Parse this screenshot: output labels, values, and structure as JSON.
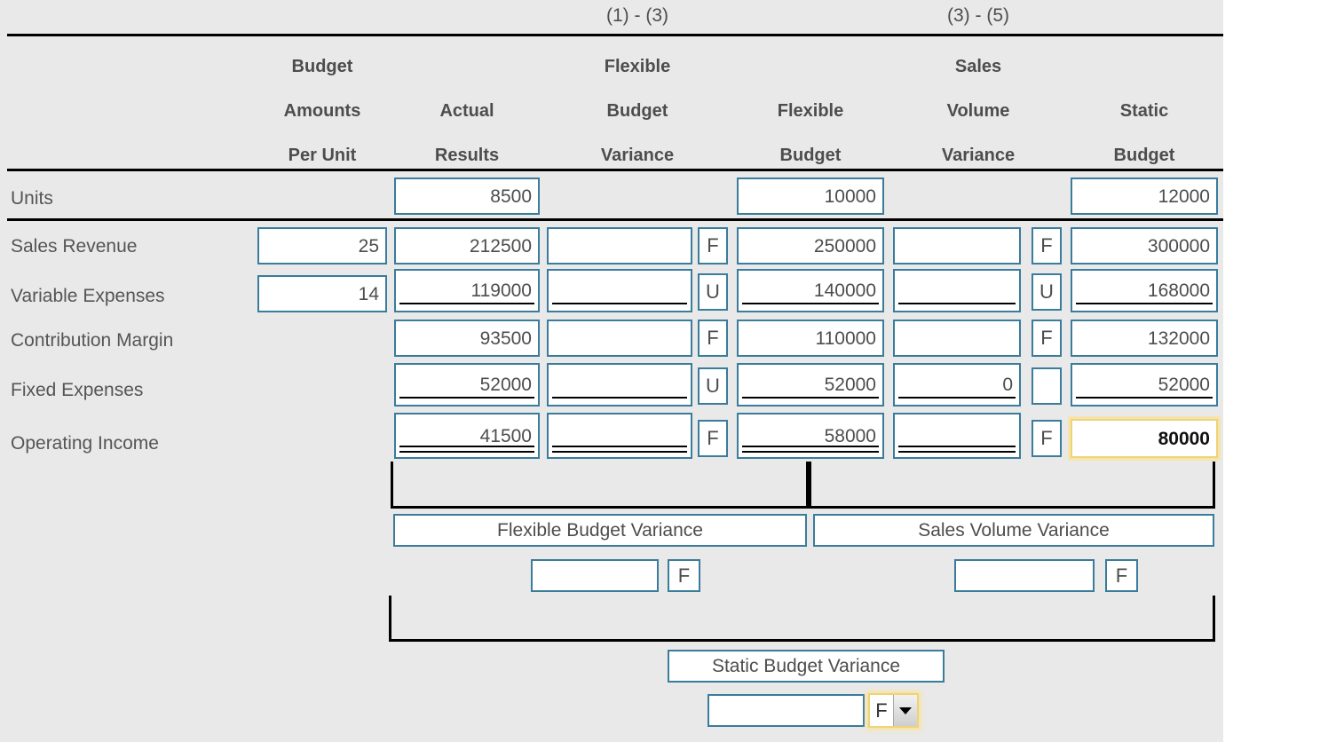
{
  "theme": {
    "page_bg": "#ffffff",
    "sheet_bg": "#e9e9e9",
    "input_border": "#3a7c9b",
    "highlight_border": "#efd27a",
    "text": "#4d4d4d",
    "rule": "#000000"
  },
  "header": {
    "equations": [
      {
        "label": "(1) - (3)"
      },
      {
        "label": "(3) - (5)"
      }
    ],
    "columns": [
      {
        "key": "budget_per_unit",
        "lines": [
          "Budget",
          "Amounts",
          "Per Unit"
        ]
      },
      {
        "key": "actual_results",
        "lines": [
          "",
          "Actual",
          "Results"
        ]
      },
      {
        "key": "flex_budget_var",
        "lines": [
          "Flexible",
          "Budget",
          "Variance"
        ]
      },
      {
        "key": "flexible_budget",
        "lines": [
          "",
          "Flexible",
          "Budget"
        ]
      },
      {
        "key": "sales_volume_var",
        "lines": [
          "Sales",
          "Volume",
          "Variance"
        ]
      },
      {
        "key": "static_budget",
        "lines": [
          "",
          "Static",
          "Budget"
        ]
      }
    ]
  },
  "rows": [
    {
      "label": "Units",
      "budget_per_unit": null,
      "actual_results": "8500",
      "flex_budget_var": null,
      "flex_budget_var_fu": null,
      "flexible_budget": "10000",
      "sales_volume_var": null,
      "sales_volume_var_fu": null,
      "static_budget": "12000",
      "underline": "none",
      "highlight_static": false
    },
    {
      "label": "Sales Revenue",
      "budget_per_unit": "25",
      "actual_results": "212500",
      "flex_budget_var": "",
      "flex_budget_var_fu": "F",
      "flexible_budget": "250000",
      "sales_volume_var": "",
      "sales_volume_var_fu": "F",
      "static_budget": "300000",
      "underline": "none",
      "highlight_static": false
    },
    {
      "label": "Variable Expenses",
      "budget_per_unit": "14",
      "actual_results": "119000",
      "flex_budget_var": "",
      "flex_budget_var_fu": "U",
      "flexible_budget": "140000",
      "sales_volume_var": "",
      "sales_volume_var_fu": "U",
      "static_budget": "168000",
      "underline": "single",
      "highlight_static": false
    },
    {
      "label": "Contribution Margin",
      "budget_per_unit": null,
      "actual_results": "93500",
      "flex_budget_var": "",
      "flex_budget_var_fu": "F",
      "flexible_budget": "110000",
      "sales_volume_var": "",
      "sales_volume_var_fu": "F",
      "static_budget": "132000",
      "underline": "none",
      "highlight_static": false
    },
    {
      "label": "Fixed Expenses",
      "budget_per_unit": null,
      "actual_results": "52000",
      "flex_budget_var": "",
      "flex_budget_var_fu": "U",
      "flexible_budget": "52000",
      "sales_volume_var": "0",
      "sales_volume_var_fu": "",
      "static_budget": "52000",
      "underline": "single",
      "highlight_static": false
    },
    {
      "label": "Operating Income",
      "budget_per_unit": null,
      "actual_results": "41500",
      "flex_budget_var": "",
      "flex_budget_var_fu": "F",
      "flexible_budget": "58000",
      "sales_volume_var": "",
      "sales_volume_var_fu": "F",
      "static_budget": "80000",
      "underline": "double",
      "highlight_static": true
    }
  ],
  "variances": {
    "flexible": {
      "title": "Flexible Budget Variance",
      "amount": "",
      "fu": "F"
    },
    "sales_volume": {
      "title": "Sales Volume Variance",
      "amount": "",
      "fu": "F"
    },
    "static": {
      "title": "Static Budget Variance",
      "amount": "",
      "fu_selected": "F",
      "fu_icon": "chevron-down-icon"
    }
  }
}
